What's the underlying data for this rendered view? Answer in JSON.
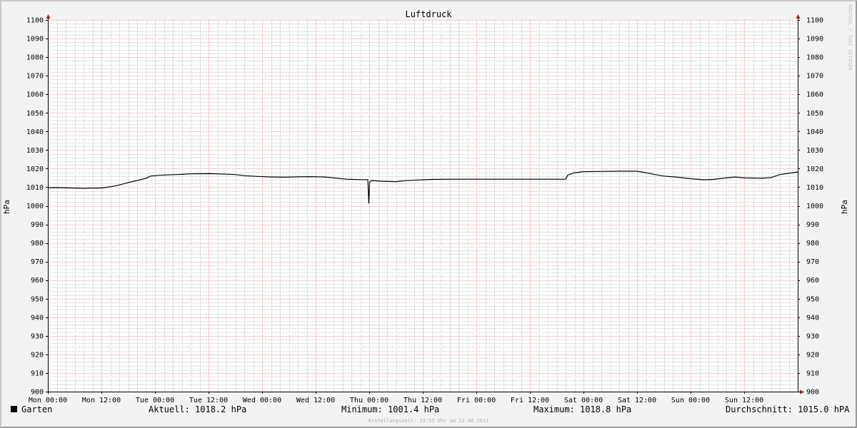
{
  "chart_data": {
    "type": "line",
    "title": "Luftdruck",
    "ylabel_left": "hPa",
    "ylabel_right": "hPa",
    "ylim": [
      900,
      1100
    ],
    "yticks": [
      900,
      910,
      920,
      930,
      940,
      950,
      960,
      970,
      980,
      990,
      1000,
      1010,
      1020,
      1030,
      1040,
      1050,
      1060,
      1070,
      1080,
      1090,
      1100
    ],
    "xlim_hours": [
      0,
      168
    ],
    "xticks": [
      {
        "hour": 0,
        "label": "Mon 00:00"
      },
      {
        "hour": 12,
        "label": "Mon 12:00"
      },
      {
        "hour": 24,
        "label": "Tue 00:00"
      },
      {
        "hour": 36,
        "label": "Tue 12:00"
      },
      {
        "hour": 48,
        "label": "Wed 00:00"
      },
      {
        "hour": 60,
        "label": "Wed 12:00"
      },
      {
        "hour": 72,
        "label": "Thu 00:00"
      },
      {
        "hour": 84,
        "label": "Thu 12:00"
      },
      {
        "hour": 96,
        "label": "Fri 00:00"
      },
      {
        "hour": 108,
        "label": "Fri 12:00"
      },
      {
        "hour": 120,
        "label": "Sat 00:00"
      },
      {
        "hour": 132,
        "label": "Sat 12:00"
      },
      {
        "hour": 144,
        "label": "Sun 00:00"
      },
      {
        "hour": 156,
        "label": "Sun 12:00"
      }
    ],
    "grid": true,
    "series": [
      {
        "name": "Garten",
        "color": "#000000",
        "points": [
          [
            0,
            1009.7
          ],
          [
            2,
            1009.8
          ],
          [
            5,
            1009.6
          ],
          [
            8,
            1009.4
          ],
          [
            12,
            1009.6
          ],
          [
            14,
            1010.2
          ],
          [
            16,
            1011.2
          ],
          [
            18,
            1012.5
          ],
          [
            20,
            1013.6
          ],
          [
            22,
            1014.8
          ],
          [
            23,
            1016.0
          ],
          [
            26,
            1016.6
          ],
          [
            29,
            1016.8
          ],
          [
            32,
            1017.2
          ],
          [
            36,
            1017.3
          ],
          [
            40,
            1017.0
          ],
          [
            42,
            1016.8
          ],
          [
            44,
            1016.2
          ],
          [
            47,
            1015.8
          ],
          [
            50,
            1015.5
          ],
          [
            53,
            1015.4
          ],
          [
            56,
            1015.6
          ],
          [
            59,
            1015.7
          ],
          [
            62,
            1015.5
          ],
          [
            64,
            1015.0
          ],
          [
            67,
            1014.3
          ],
          [
            70,
            1014.1
          ],
          [
            71.7,
            1014.1
          ],
          [
            71.9,
            1001.4
          ],
          [
            72.1,
            1012.9
          ],
          [
            72.5,
            1013.6
          ],
          [
            75,
            1013.2
          ],
          [
            78,
            1013.0
          ],
          [
            80,
            1013.5
          ],
          [
            83,
            1013.9
          ],
          [
            86,
            1014.2
          ],
          [
            90,
            1014.3
          ],
          [
            100,
            1014.3
          ],
          [
            110,
            1014.3
          ],
          [
            116,
            1014.3
          ],
          [
            116.5,
            1016.6
          ],
          [
            118,
            1017.8
          ],
          [
            120,
            1018.4
          ],
          [
            124,
            1018.5
          ],
          [
            128,
            1018.6
          ],
          [
            132,
            1018.6
          ],
          [
            134,
            1017.8
          ],
          [
            136,
            1016.8
          ],
          [
            138,
            1016.0
          ],
          [
            141,
            1015.4
          ],
          [
            144,
            1014.6
          ],
          [
            147,
            1014.0
          ],
          [
            149,
            1014.2
          ],
          [
            152,
            1015.0
          ],
          [
            154,
            1015.5
          ],
          [
            156,
            1015.0
          ],
          [
            160,
            1014.8
          ],
          [
            162,
            1015.2
          ],
          [
            164,
            1016.8
          ],
          [
            166,
            1017.5
          ],
          [
            168,
            1018.2
          ]
        ]
      }
    ]
  },
  "legend": {
    "series_name": "Garten",
    "swatch_color": "#000000",
    "aktuell": "Aktuell: 1018.2 hPa",
    "minimum": "Minimum: 1001.4 hPa",
    "maximum": "Maximum: 1018.8 hPa",
    "durchschnitt": "Durchschnitt: 1015.0 hPA"
  },
  "footer": {
    "created": "Erstellungszeit: 23:55 Uhr am 22.08.2021"
  },
  "watermark": "RRDTOOL / TOBI OETIKER",
  "colors": {
    "background": "#f3f3f3",
    "plot_background": "#ffffff",
    "major_grid": "#e8a0a0",
    "minor_grid": "#c8c8c8",
    "axis": "#000000",
    "arrow": "#a02020"
  }
}
